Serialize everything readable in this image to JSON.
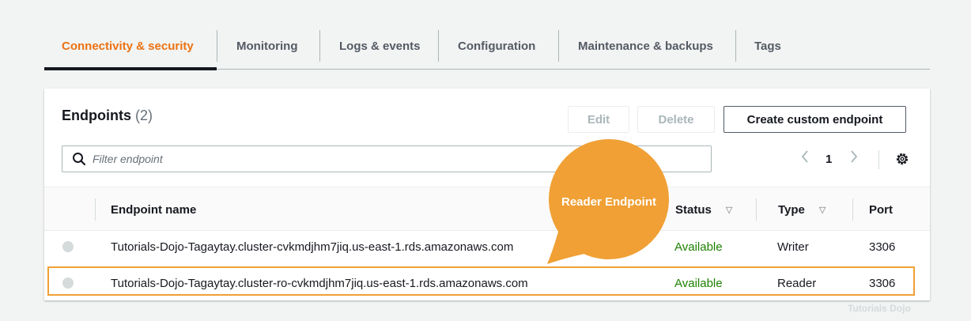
{
  "tabs": [
    {
      "label": "Connectivity & security",
      "active": true
    },
    {
      "label": "Monitoring",
      "active": false
    },
    {
      "label": "Logs & events",
      "active": false
    },
    {
      "label": "Configuration",
      "active": false
    },
    {
      "label": "Maintenance & backups",
      "active": false
    },
    {
      "label": "Tags",
      "active": false
    }
  ],
  "panel": {
    "title": "Endpoints",
    "count": "(2)",
    "buttons": {
      "edit": "Edit",
      "delete": "Delete",
      "create": "Create custom endpoint"
    },
    "search_placeholder": "Filter endpoint",
    "pager": {
      "prev_icon": "chevron-left-icon",
      "page": "1",
      "next_icon": "chevron-right-icon"
    },
    "settings_icon": "gear-icon"
  },
  "table": {
    "headers": {
      "name": "Endpoint name",
      "status": "Status",
      "type": "Type",
      "port": "Port"
    },
    "rows": [
      {
        "name": "Tutorials-Dojo-Tagaytay.cluster-cvkmdjhm7jiq.us-east-1.rds.amazonaws.com",
        "status": "Available",
        "type": "Writer",
        "port": "3306"
      },
      {
        "name": "Tutorials-Dojo-Tagaytay.cluster-ro-cvkmdjhm7jiq.us-east-1.rds.amazonaws.com",
        "status": "Available",
        "type": "Reader",
        "port": "3306"
      }
    ]
  },
  "annotation": {
    "callout_text": "Reader Endpoint",
    "callout_color": "#f0a034",
    "highlight_color": "#f0a034"
  },
  "watermark": "Tutorials Dojo",
  "colors": {
    "accent": "#ec7211",
    "status_available": "#1d8102"
  }
}
